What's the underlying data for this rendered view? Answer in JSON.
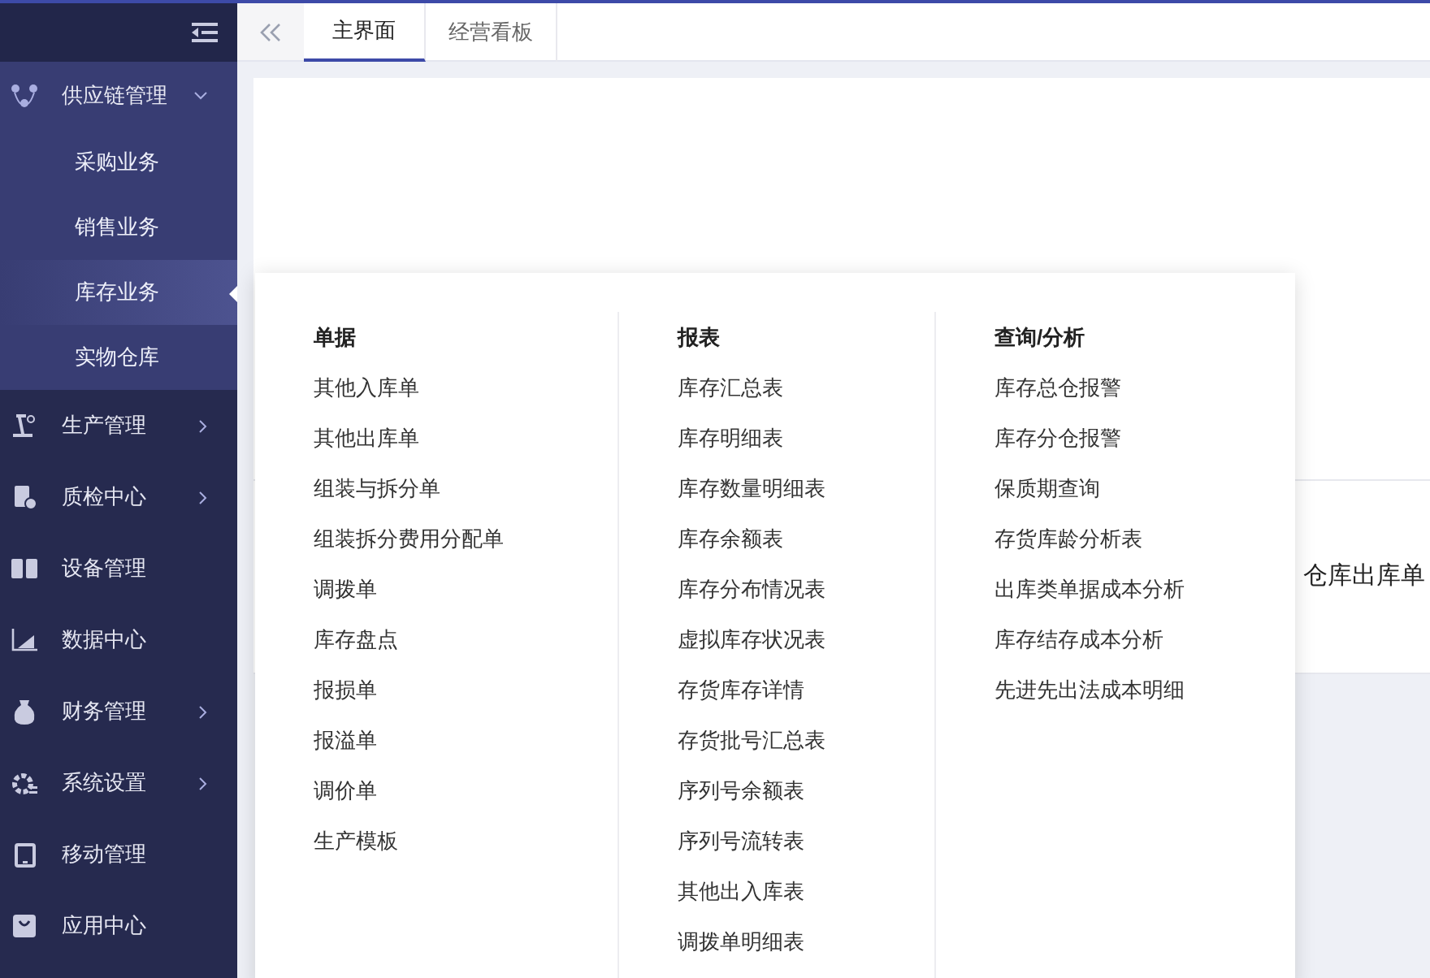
{
  "sidebar": {
    "items": [
      {
        "label": "供应链管理",
        "kind": "group",
        "expanded": true,
        "children": [
          {
            "label": "采购业务",
            "selected": false
          },
          {
            "label": "销售业务",
            "selected": false
          },
          {
            "label": "库存业务",
            "selected": true
          },
          {
            "label": "实物仓库",
            "selected": false
          }
        ]
      },
      {
        "label": "生产管理",
        "kind": "group",
        "expanded": false
      },
      {
        "label": "质检中心",
        "kind": "group",
        "expanded": false
      },
      {
        "label": "设备管理",
        "kind": "link"
      },
      {
        "label": "数据中心",
        "kind": "link"
      },
      {
        "label": "财务管理",
        "kind": "group",
        "expanded": false
      },
      {
        "label": "系统设置",
        "kind": "group",
        "expanded": false
      },
      {
        "label": "移动管理",
        "kind": "link"
      },
      {
        "label": "应用中心",
        "kind": "link"
      }
    ]
  },
  "tabs": [
    {
      "label": "主界面",
      "selected": true
    },
    {
      "label": "经营看板",
      "selected": false
    }
  ],
  "background_card": {
    "title": "仓库出库单"
  },
  "flyout": {
    "columns": [
      {
        "heading": "单据",
        "items": [
          "其他入库单",
          "其他出库单",
          "组装与拆分单",
          "组装拆分费用分配单",
          "调拨单",
          "库存盘点",
          "报损单",
          "报溢单",
          "调价单",
          "生产模板"
        ]
      },
      {
        "heading": "报表",
        "items": [
          "库存汇总表",
          "库存明细表",
          "库存数量明细表",
          "库存余额表",
          "库存分布情况表",
          "虚拟库存状况表",
          "存货库存详情",
          "存货批号汇总表",
          "序列号余额表",
          "序列号流转表",
          "其他出入库表",
          "调拨单明细表"
        ]
      },
      {
        "heading": "查询/分析",
        "items": [
          "库存总仓报警",
          "库存分仓报警",
          "保质期查询",
          "存货库龄分析表",
          "出库类单据成本分析",
          "库存结存成本分析",
          "先进先出法成本明细"
        ]
      }
    ]
  }
}
